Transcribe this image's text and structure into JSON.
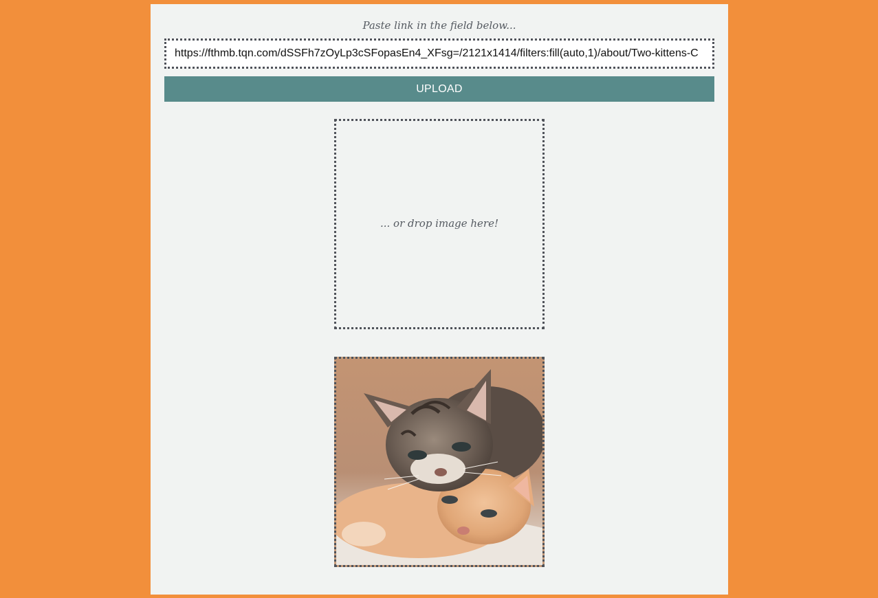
{
  "form": {
    "paste_hint": "Paste link in the field below...",
    "url_value": "https://fthmb.tqn.com/dSSFh7zOyLp3cSFopasEn4_XFsg=/2121x1414/filters:fill(auto,1)/about/Two-kittens-C",
    "upload_label": "UPLOAD"
  },
  "dropzone": {
    "hint": "... or drop image here!"
  },
  "preview": {
    "subject": "two kittens photo"
  },
  "colors": {
    "background": "#f28f3b",
    "panel": "#f1f3f2",
    "button": "#588b8b",
    "border": "#4f5259"
  }
}
